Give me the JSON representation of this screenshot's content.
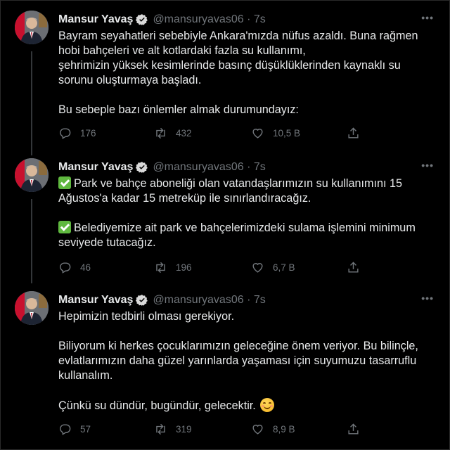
{
  "colors": {
    "background": "#000000",
    "text": "#e7e9ea",
    "muted": "#71767b",
    "verified": "#d9d9d9",
    "check_emoji": "#5fb83f"
  },
  "tweets": [
    {
      "name": "Mansur Yavaş",
      "handle": "@mansuryavas06 · 7s",
      "lines": [
        "Bayram seyahatleri sebebiyle Ankara'mızda nüfus azaldı. Buna rağmen",
        "hobi bahçeleri ve alt kotlardaki fazla su kullanımı,",
        "şehrimizin yüksek kesimlerinde basınç düşüklüklerinden kaynaklı su",
        "sorunu oluşturmaya başladı.",
        "Bu sebeple bazı önlemler almak durumundayız:"
      ],
      "replies": "176",
      "retweets": "432",
      "likes": "10,5 B"
    },
    {
      "name": "Mansur Yavaş",
      "handle": "@mansuryavas06 · 7s",
      "lines": [
        "Park ve bahçe aboneliği olan vatandaşlarımızın su kullanımını 15",
        "Ağustos'a kadar 15 metreküp ile sınırlandıracağız.",
        "Belediyemize ait park ve bahçelerimizdeki sulama işlemini minimum",
        "seviyede tutacağız."
      ],
      "replies": "46",
      "retweets": "196",
      "likes": "6,7 B"
    },
    {
      "name": "Mansur Yavaş",
      "handle": "@mansuryavas06 · 7s",
      "lines": [
        "Hepimizin tedbirli olması gerekiyor.",
        "Biliyorum ki herkes çocuklarımızın geleceğine önem veriyor. Bu bilinçle,",
        "evlatlarımızın daha güzel yarınlarda yaşaması için suyumuzu tasarruflu",
        "kullanalım.",
        "Çünkü su dündür, bugündür, gelecektir."
      ],
      "replies": "57",
      "retweets": "319",
      "likes": "8,9 B"
    }
  ],
  "icons": [
    "avatar-portrait",
    "verified-badge-icon",
    "more-icon",
    "check-mark-emoji",
    "smiling-face-emoji",
    "reply-icon",
    "retweet-icon",
    "like-icon",
    "share-icon"
  ]
}
